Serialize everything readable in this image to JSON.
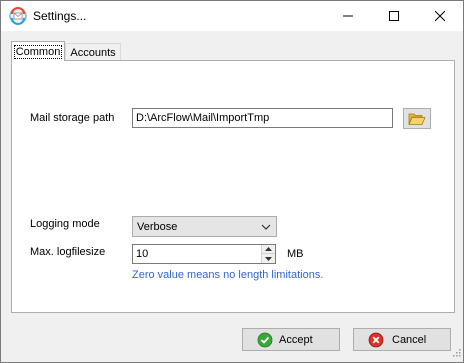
{
  "window": {
    "title": "Settings..."
  },
  "tabs": [
    {
      "label": "Common",
      "selected": true
    },
    {
      "label": "Accounts",
      "selected": false
    }
  ],
  "common": {
    "mail_storage": {
      "label": "Mail storage path",
      "value": "D:\\ArcFlow\\Mail\\ImportTmp"
    },
    "logging_mode": {
      "label": "Logging mode",
      "value": "Verbose"
    },
    "max_logfilesize": {
      "label": "Max. logfilesize",
      "value": "10",
      "unit": "MB",
      "hint": "Zero value means no length limitations."
    }
  },
  "buttons": {
    "accept": "Accept",
    "cancel": "Cancel"
  },
  "colors": {
    "hint": "#3366cc",
    "accept_icon": "#3aa83a",
    "cancel_icon": "#d9322b"
  }
}
